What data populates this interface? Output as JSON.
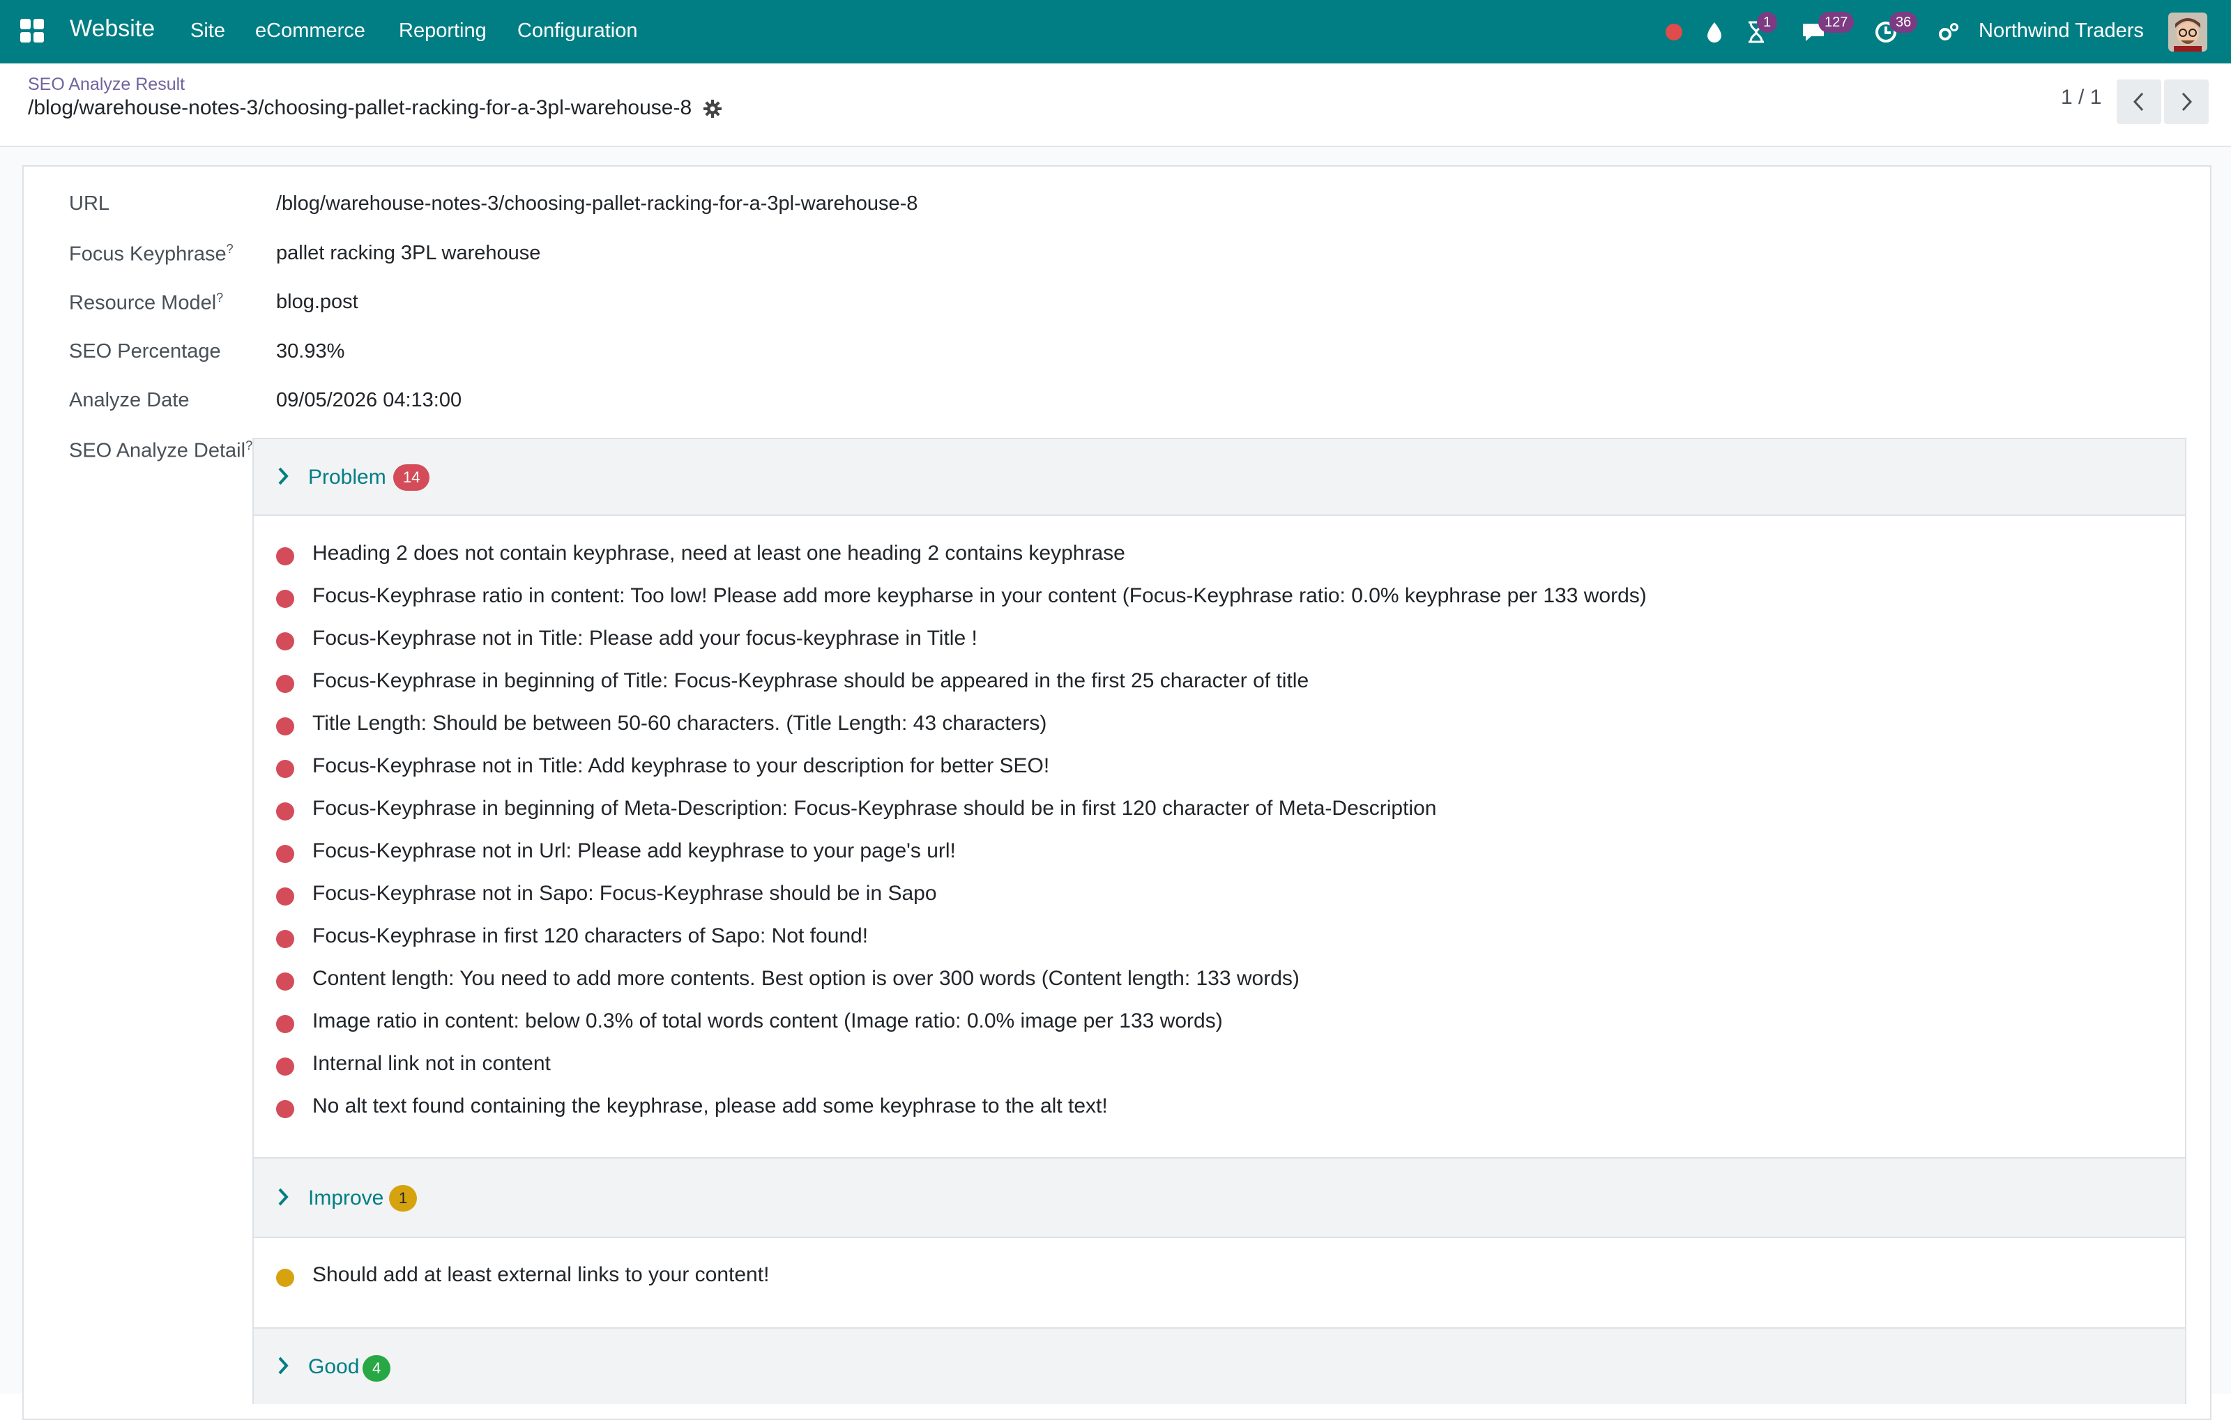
{
  "navbar": {
    "brand": "Website",
    "menu": [
      "Site",
      "eCommerce",
      "Reporting",
      "Configuration"
    ],
    "activity_badge": "1",
    "messages_badge": "127",
    "clock_badge": "36",
    "company": "Northwind Traders",
    "bg_color": "#017e84"
  },
  "control": {
    "breadcrumb": "SEO Analyze Result",
    "title": "/blog/warehouse-notes-3/choosing-pallet-racking-for-a-3pl-warehouse-8",
    "pager": "1 / 1"
  },
  "fields": {
    "url": {
      "label": "URL",
      "value": "/blog/warehouse-notes-3/choosing-pallet-racking-for-a-3pl-warehouse-8"
    },
    "keyphrase": {
      "label": "Focus Keyphrase",
      "help": "?",
      "value": "pallet racking 3PL warehouse"
    },
    "model": {
      "label": "Resource Model",
      "help": "?",
      "value": "blog.post"
    },
    "percentage": {
      "label": "SEO Percentage",
      "value": "30.93%"
    },
    "date": {
      "label": "Analyze Date",
      "value": "09/05/2026 04:13:00"
    },
    "detail": {
      "label": "SEO Analyze Detail",
      "help": "?"
    }
  },
  "sections": {
    "problem": {
      "title": "Problem",
      "count": "14",
      "color": "#d44c59",
      "items": [
        "Heading 2 does not contain keyphrase, need at least one heading 2 contains keyphrase",
        "Focus-Keyphrase ratio in content: Too low! Please add more keypharse in your content (Focus-Keyphrase ratio: 0.0% keyphrase per 133 words)",
        "Focus-Keyphrase not in Title: Please add your focus-keyphrase in Title !",
        "Focus-Keyphrase in beginning of Title: Focus-Keyphrase should be appeared in the first 25 character of title",
        "Title Length: Should be between 50-60 characters. (Title Length: 43 characters)",
        "Focus-Keyphrase not in Title: Add keyphrase to your description for better SEO!",
        "Focus-Keyphrase in beginning of Meta-Description: Focus-Keyphrase should be in first 120 character of Meta-Description",
        "Focus-Keyphrase not in Url: Please add keyphrase to your page's url!",
        "Focus-Keyphrase not in Sapo: Focus-Keyphrase should be in Sapo",
        "Focus-Keyphrase in first 120 characters of Sapo: Not found!",
        "Content length: You need to add more contents. Best option is over 300 words (Content length: 133 words)",
        "Image ratio in content: below 0.3% of total words content (Image ratio: 0.0% image per 133 words)",
        "Internal link not in content",
        "No alt text found containing the keyphrase, please add some keyphrase to the alt text!"
      ]
    },
    "improve": {
      "title": "Improve",
      "count": "1",
      "color": "#d6a20e",
      "items": [
        "Should add at least external links to your content!"
      ]
    },
    "good": {
      "title": "Good",
      "count": "4",
      "color": "#28a745"
    }
  }
}
